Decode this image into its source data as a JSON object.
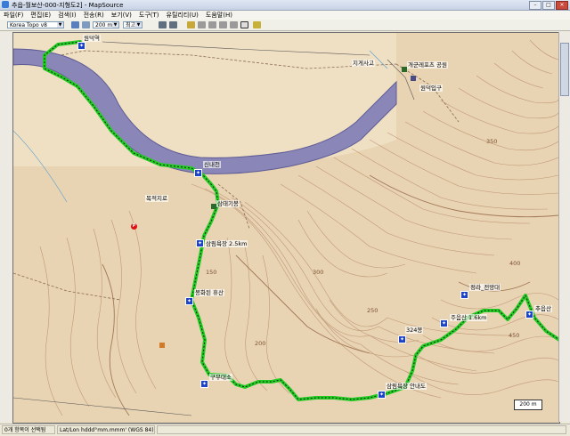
{
  "window": {
    "title": "추읍-월보산-000-지형도2] - MapSource",
    "controls": [
      "–",
      "□",
      "×"
    ]
  },
  "menu": [
    "파일(F)",
    "편집(E)",
    "검색(I)",
    "전송(R)",
    "보기(V)",
    "도구(T)",
    "유틸리티(U)",
    "도움말(H)"
  ],
  "toolbar": {
    "map_product": "Korea Topo v8",
    "zoom": "200 m",
    "detail": "최고"
  },
  "map": {
    "labels": [
      {
        "text": "원덕역",
        "color": "#000"
      },
      {
        "text": "목적지로",
        "color": "#000"
      },
      {
        "text": "신내천",
        "color": "#000"
      },
      {
        "text": "삼림욕장 2.5km",
        "color": "#000"
      },
      {
        "text": "봉화된 휴산",
        "color": "#000"
      },
      {
        "text": "구부대소",
        "color": "#000"
      },
      {
        "text": "삼림욕장 안내도",
        "color": "#000"
      },
      {
        "text": "324봉",
        "color": "#000"
      },
      {
        "text": "주음산 1.6km",
        "color": "#000"
      },
      {
        "text": "정라_전망대",
        "color": "#000"
      },
      {
        "text": "추읍산",
        "color": "#000"
      },
      {
        "text": "지게사고",
        "color": "#000"
      },
      {
        "text": "삼태기봉",
        "color": "#000"
      },
      {
        "text": "원덕입구",
        "color": "#000"
      },
      {
        "text": "개군레포츠 공원",
        "color": "#000"
      }
    ],
    "contour_values": [
      "150",
      "200",
      "250",
      "300",
      "350",
      "400",
      "450"
    ],
    "scale_label": "200 m",
    "route_color": "#22cc22",
    "river_color": "#8a87b8"
  },
  "status": {
    "left": "0개 항목이 선택됨",
    "format": "Lat/Lon hddd°mm.mmm' (WGS 84)"
  }
}
